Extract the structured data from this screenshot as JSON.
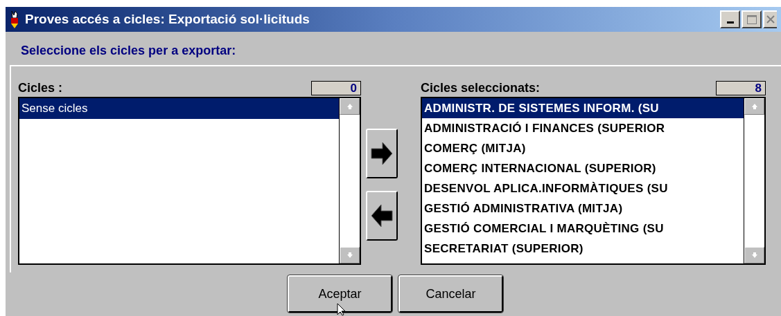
{
  "window": {
    "title": "Proves accés a cicles: Exportació sol·licituds"
  },
  "instruction": "Seleccione els cicles per a exportar:",
  "available": {
    "label": "Cicles :",
    "count": "0",
    "items": [
      {
        "label": "Sense cicles",
        "selected": true
      }
    ]
  },
  "selected_list": {
    "label": "Cicles seleccionats:",
    "count": "8",
    "items": [
      {
        "label": "ADMINISTR. DE SISTEMES INFORM. (SU",
        "selected": true
      },
      {
        "label": "ADMINISTRACIÓ I FINANCES (SUPERIOR",
        "selected": false
      },
      {
        "label": "COMERÇ (MITJA)",
        "selected": false
      },
      {
        "label": "COMERÇ INTERNACIONAL (SUPERIOR)",
        "selected": false
      },
      {
        "label": "DESENVOL APLICA.INFORMÀTIQUES (SU",
        "selected": false
      },
      {
        "label": "GESTIÓ ADMINISTRATIVA (MITJA)",
        "selected": false
      },
      {
        "label": "GESTIÓ COMERCIAL I MARQUÈTING (SU",
        "selected": false
      },
      {
        "label": "SECRETARIAT (SUPERIOR)",
        "selected": false
      }
    ]
  },
  "buttons": [
    "Aceptar",
    "Cancelar"
  ]
}
